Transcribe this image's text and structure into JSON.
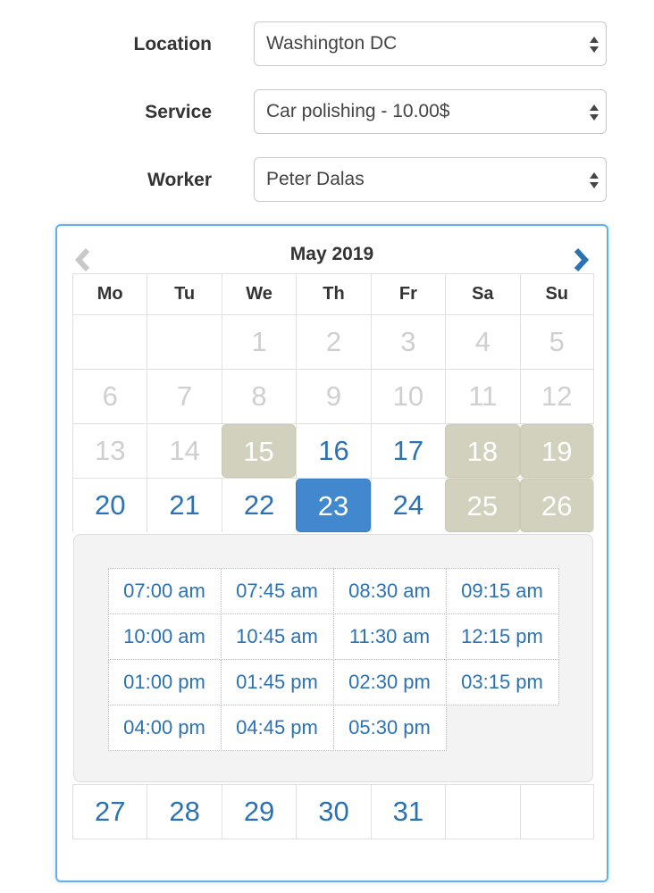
{
  "form": {
    "location": {
      "label": "Location",
      "value": "Washington DC"
    },
    "service": {
      "label": "Service",
      "value": "Car polishing - 10.00$"
    },
    "worker": {
      "label": "Worker",
      "value": "Peter Dalas"
    }
  },
  "calendar": {
    "title": "May 2019",
    "prev_icon": "chevron-left-icon",
    "next_icon": "chevron-right-icon",
    "colors": {
      "available": "#2b72b5",
      "past": "#cfcfcf",
      "booked": "#d1d1bd",
      "selected": "#4188cf",
      "border": "#66aee9"
    },
    "weekdays": [
      "Mo",
      "Tu",
      "We",
      "Th",
      "Fr",
      "Sa",
      "Su"
    ],
    "weeks": [
      [
        {
          "day": "",
          "state": "empty"
        },
        {
          "day": "",
          "state": "empty"
        },
        {
          "day": "1",
          "state": "past"
        },
        {
          "day": "2",
          "state": "past"
        },
        {
          "day": "3",
          "state": "past"
        },
        {
          "day": "4",
          "state": "past"
        },
        {
          "day": "5",
          "state": "past"
        }
      ],
      [
        {
          "day": "6",
          "state": "past"
        },
        {
          "day": "7",
          "state": "past"
        },
        {
          "day": "8",
          "state": "past"
        },
        {
          "day": "9",
          "state": "past"
        },
        {
          "day": "10",
          "state": "past"
        },
        {
          "day": "11",
          "state": "past"
        },
        {
          "day": "12",
          "state": "past"
        }
      ],
      [
        {
          "day": "13",
          "state": "past"
        },
        {
          "day": "14",
          "state": "past"
        },
        {
          "day": "15",
          "state": "booked"
        },
        {
          "day": "16",
          "state": "avail"
        },
        {
          "day": "17",
          "state": "avail"
        },
        {
          "day": "18",
          "state": "booked"
        },
        {
          "day": "19",
          "state": "booked"
        }
      ],
      [
        {
          "day": "20",
          "state": "avail"
        },
        {
          "day": "21",
          "state": "avail"
        },
        {
          "day": "22",
          "state": "avail"
        },
        {
          "day": "23",
          "state": "selected"
        },
        {
          "day": "24",
          "state": "avail"
        },
        {
          "day": "25",
          "state": "booked"
        },
        {
          "day": "26",
          "state": "booked"
        }
      ],
      [
        {
          "day": "27",
          "state": "avail"
        },
        {
          "day": "28",
          "state": "avail"
        },
        {
          "day": "29",
          "state": "avail"
        },
        {
          "day": "30",
          "state": "avail"
        },
        {
          "day": "31",
          "state": "avail"
        },
        {
          "day": "",
          "state": "empty"
        },
        {
          "day": "",
          "state": "empty"
        }
      ]
    ],
    "selected_day": "23",
    "time_slots": [
      "07:00 am",
      "07:45 am",
      "08:30 am",
      "09:15 am",
      "10:00 am",
      "10:45 am",
      "11:30 am",
      "12:15 pm",
      "01:00 pm",
      "01:45 pm",
      "02:30 pm",
      "03:15 pm",
      "04:00 pm",
      "04:45 pm",
      "05:30 pm"
    ]
  }
}
